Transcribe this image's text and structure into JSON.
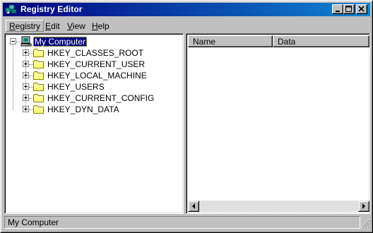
{
  "window": {
    "title": "Registry Editor",
    "title_icon": "registry-editor-icon",
    "controls": [
      "minimize-icon",
      "maximize-icon",
      "close-icon"
    ]
  },
  "menu": {
    "items": [
      {
        "label": "Registry",
        "accel": "R",
        "rest": "egistry"
      },
      {
        "label": "Edit",
        "accel": "E",
        "rest": "dit"
      },
      {
        "label": "View",
        "accel": "V",
        "rest": "iew"
      },
      {
        "label": "Help",
        "accel": "H",
        "rest": "elp"
      }
    ]
  },
  "tree": {
    "root": {
      "label": "My Computer",
      "icon": "computer-icon",
      "expanded": true,
      "selected": true
    },
    "keys": [
      {
        "label": "HKEY_CLASSES_ROOT",
        "icon": "folder-icon"
      },
      {
        "label": "HKEY_CURRENT_USER",
        "icon": "folder-icon"
      },
      {
        "label": "HKEY_LOCAL_MACHINE",
        "icon": "folder-icon"
      },
      {
        "label": "HKEY_USERS",
        "icon": "folder-icon"
      },
      {
        "label": "HKEY_CURRENT_CONFIG",
        "icon": "folder-icon"
      },
      {
        "label": "HKEY_DYN_DATA",
        "icon": "folder-icon"
      }
    ]
  },
  "list": {
    "columns": [
      "Name",
      "Data"
    ],
    "rows": []
  },
  "status": {
    "text": "My Computer"
  },
  "colors": {
    "titlebar_start": "#000080",
    "titlebar_end": "#1084d0",
    "face": "#c0c0c0",
    "selection": "#000080",
    "folder": "#ffff80"
  }
}
